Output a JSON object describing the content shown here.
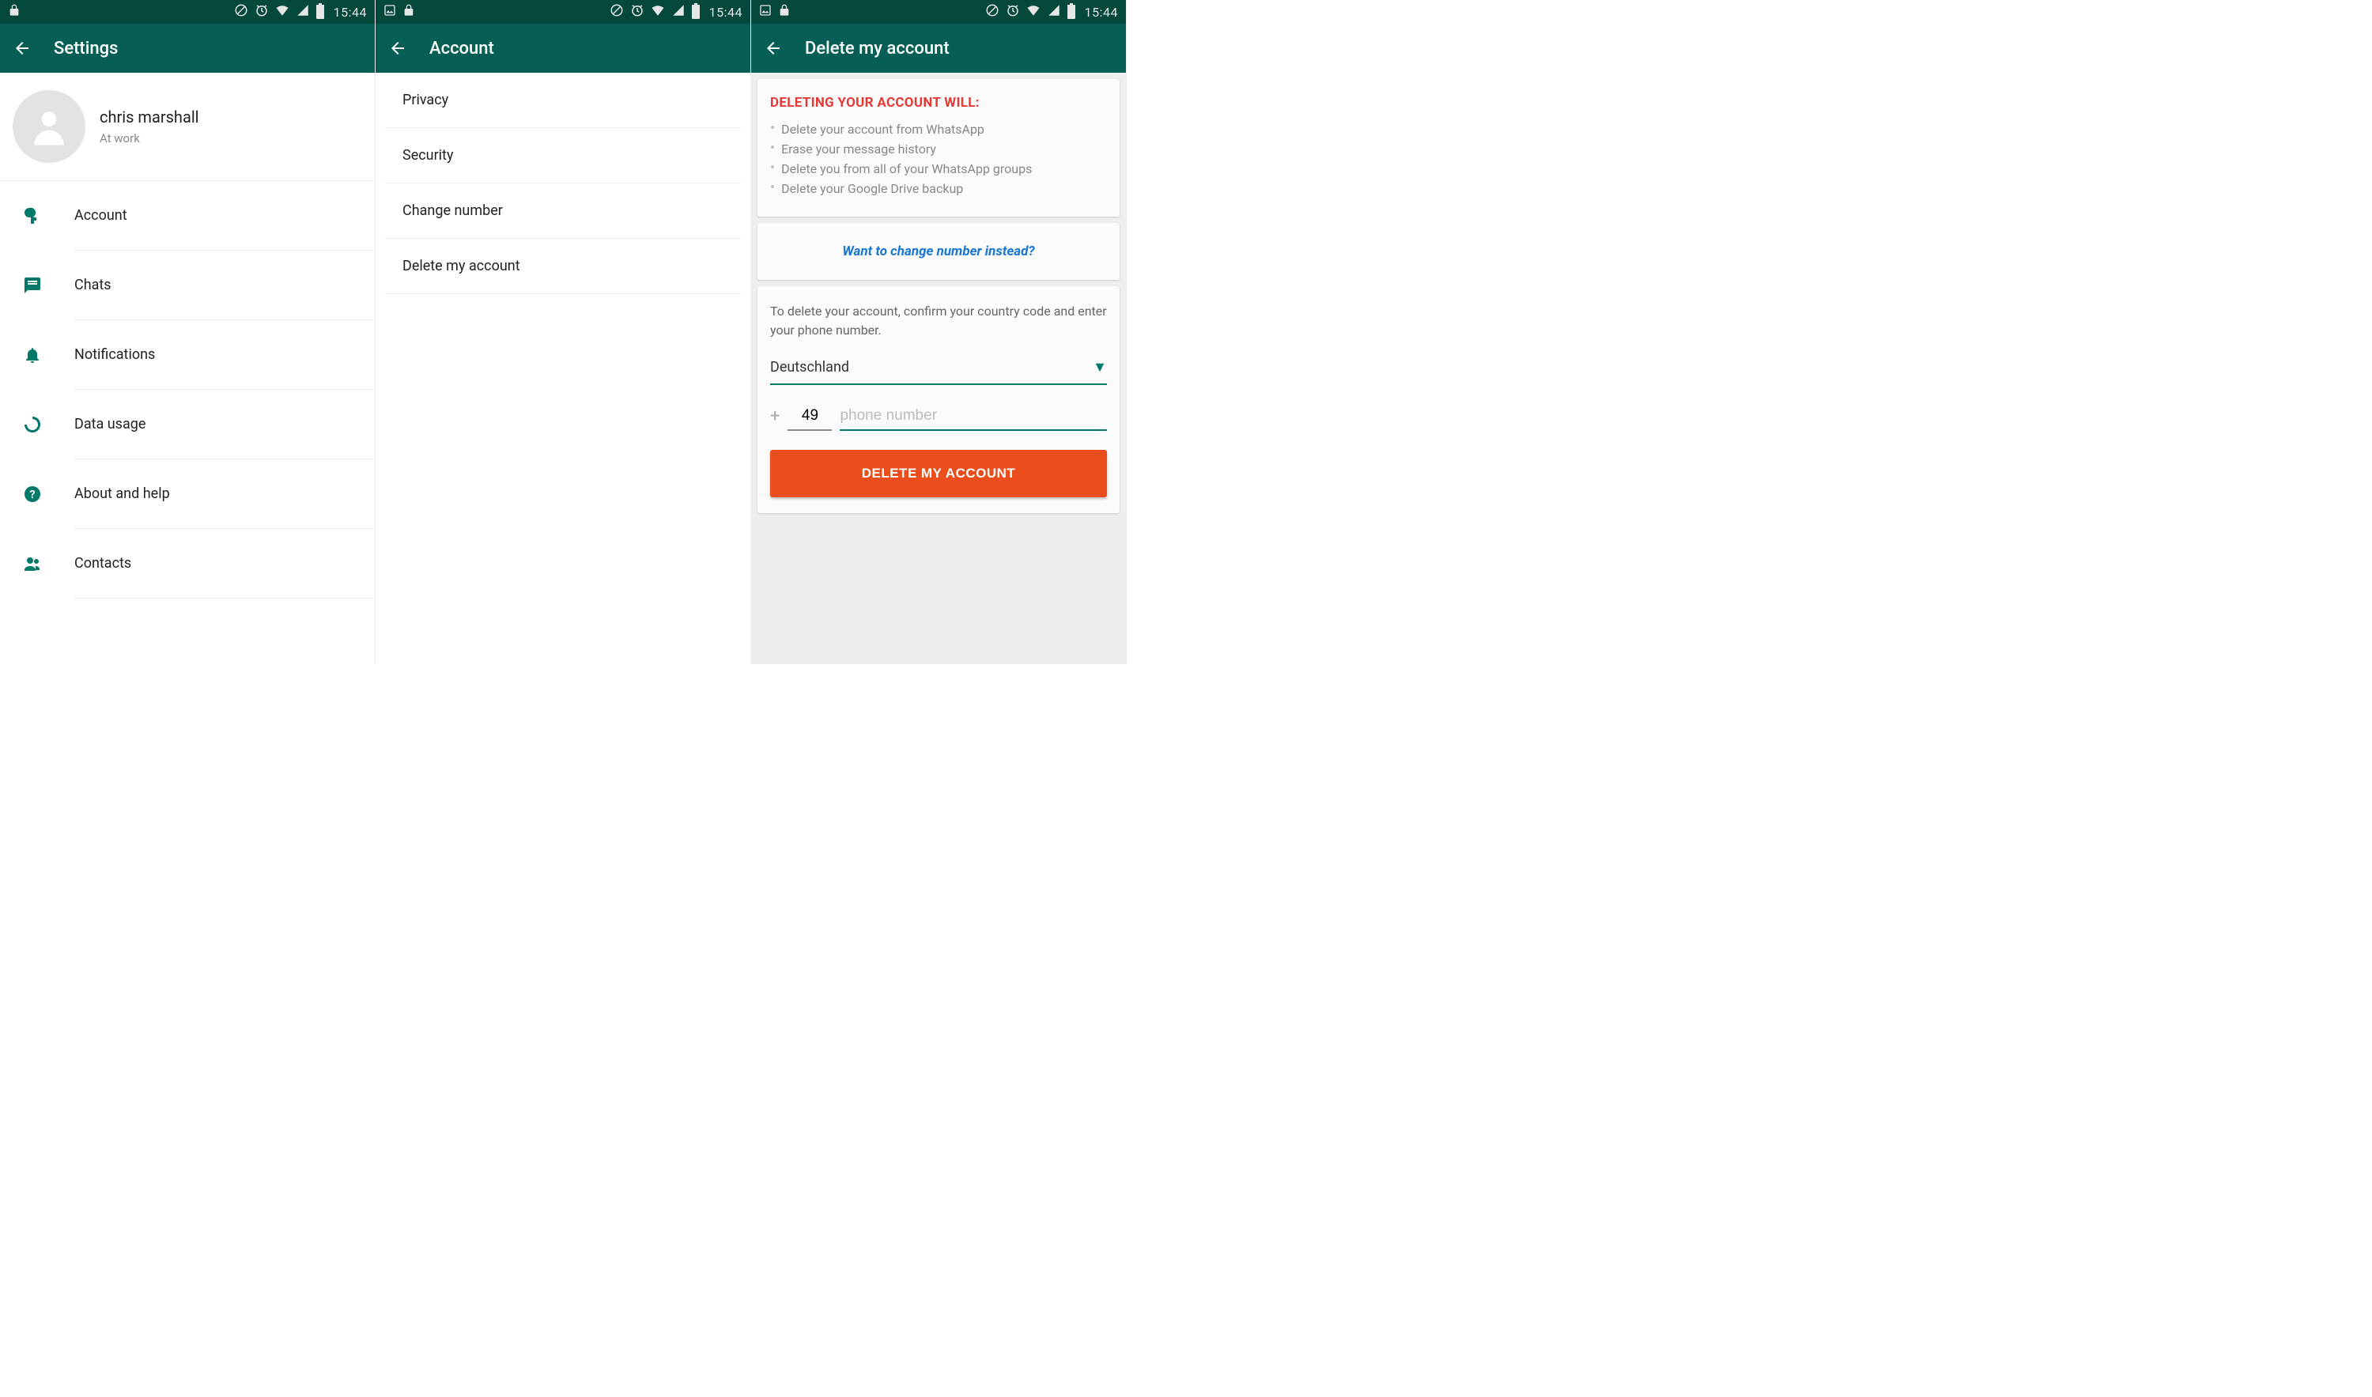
{
  "status": {
    "time": "15:44"
  },
  "screen1": {
    "title": "Settings",
    "profile": {
      "name": "chris marshall",
      "status": "At work"
    },
    "items": [
      {
        "label": "Account"
      },
      {
        "label": "Chats"
      },
      {
        "label": "Notifications"
      },
      {
        "label": "Data usage"
      },
      {
        "label": "About and help"
      },
      {
        "label": "Contacts"
      }
    ]
  },
  "screen2": {
    "title": "Account",
    "items": [
      {
        "label": "Privacy"
      },
      {
        "label": "Security"
      },
      {
        "label": "Change number"
      },
      {
        "label": "Delete my account"
      }
    ]
  },
  "screen3": {
    "title": "Delete my account",
    "warn_title": "DELETING YOUR ACCOUNT WILL:",
    "bullets": [
      "Delete your account from WhatsApp",
      "Erase your message history",
      "Delete you from all of your WhatsApp groups",
      "Delete your Google Drive backup"
    ],
    "change_link": "Want to change number instead?",
    "instruction": "To delete your account, confirm your country code and enter your phone number.",
    "country": "Deutschland",
    "country_code": "49",
    "phone_placeholder": "phone number",
    "button": "DELETE MY ACCOUNT"
  }
}
